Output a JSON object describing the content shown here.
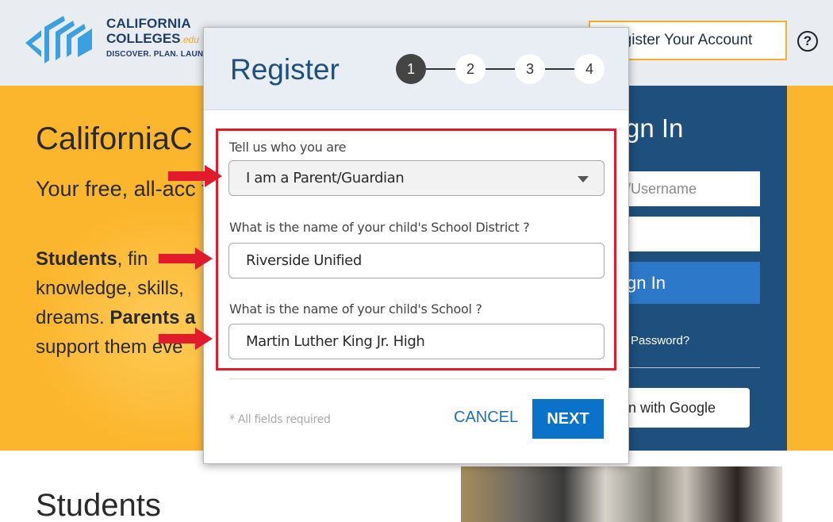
{
  "header": {
    "brand_line1": "CALIFORNIA",
    "brand_line2": "COLLEGES",
    "brand_suffix": ".edu",
    "tagline": "DISCOVER. PLAN. LAUNC",
    "register_account_label": "gister Your Account",
    "help_icon": "?"
  },
  "hero": {
    "title": "CaliforniaC",
    "subtitle": "Your free, all-acc future.",
    "body_students": "Students",
    "body_part1": ", fin",
    "body_part2": " knowledge, skills, dreams. ",
    "body_parents": "Parents a",
    "body_part3": " support them eve"
  },
  "signin": {
    "title": "gn In",
    "email_placeholder": "/Username",
    "button_label": "gn In",
    "forgot_label": "Password?",
    "google_label": "n with Google"
  },
  "section": {
    "students_heading": "Students"
  },
  "modal": {
    "title": "Register",
    "steps": [
      "1",
      "2",
      "3",
      "4"
    ],
    "active_step": 1,
    "who_label": "Tell us who you are",
    "who_value": "I am a Parent/Guardian",
    "district_label": "What is the name of your child's School District ?",
    "district_value": "Riverside Unified",
    "school_label": "What is the name of your child's School ?",
    "school_value": "Martin Luther King Jr. High",
    "required_note": "* All fields required",
    "cancel_label": "CANCEL",
    "next_label": "NEXT"
  },
  "colors": {
    "hero_yellow": "#fbb62d",
    "signin_blue": "#1e4f7d",
    "accent_blue": "#0a72c8",
    "highlight_red": "#e21b2c"
  }
}
